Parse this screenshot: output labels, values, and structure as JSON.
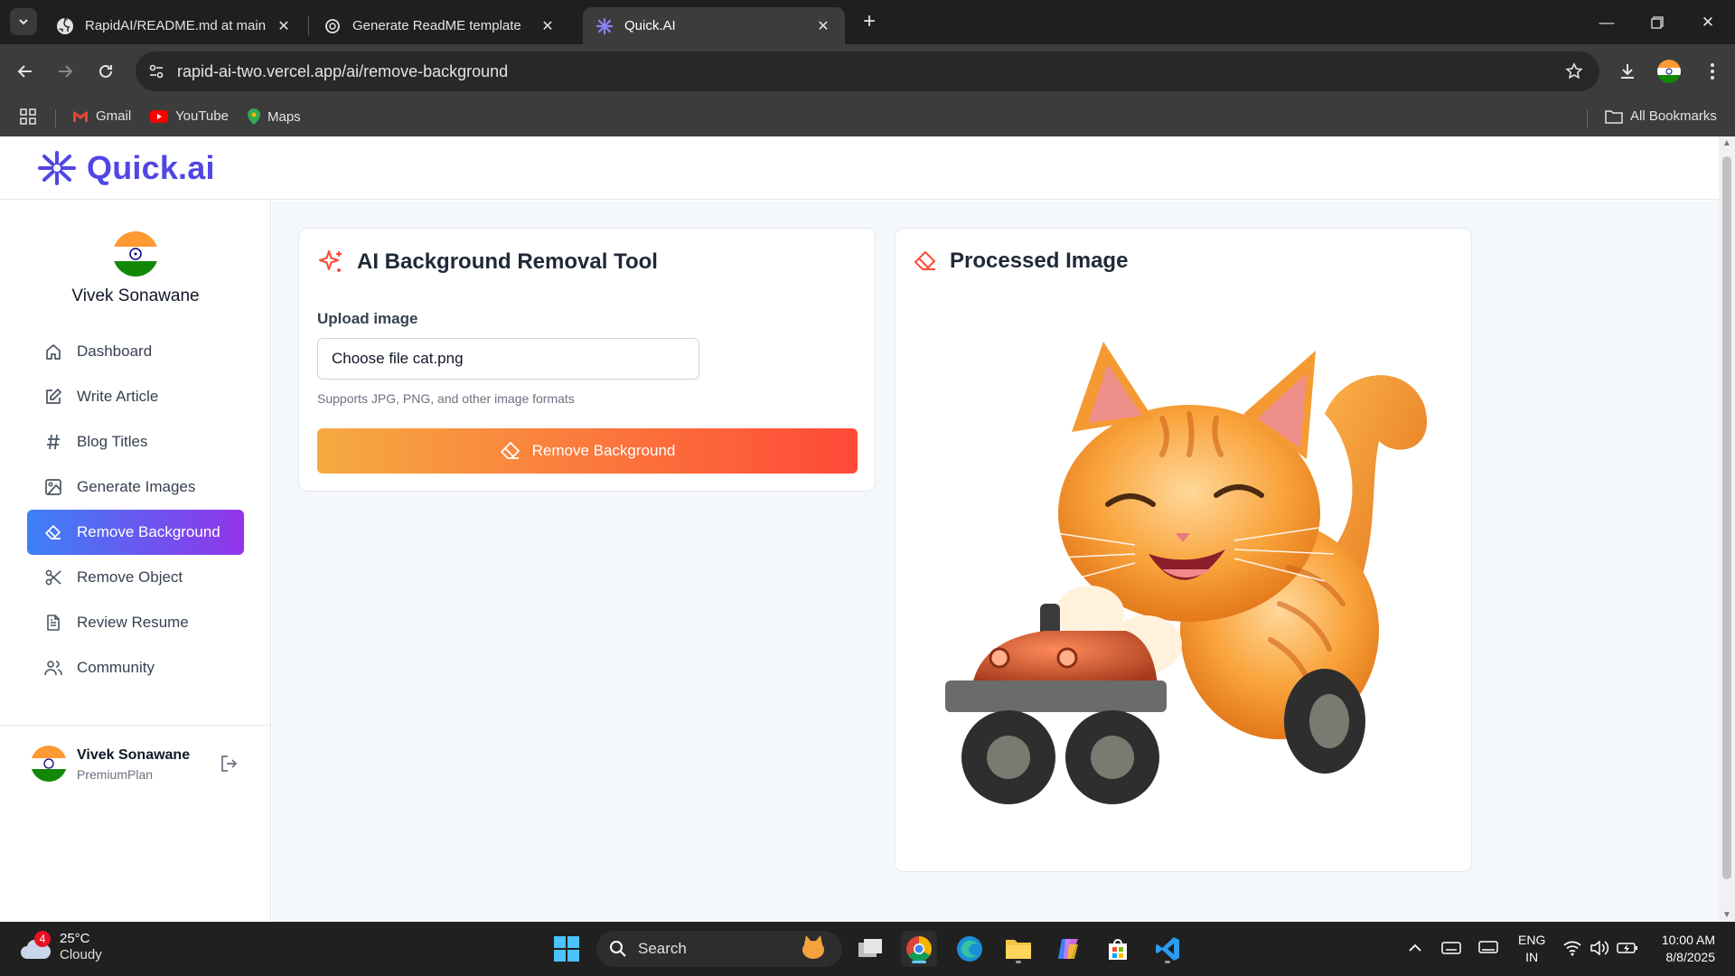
{
  "browser": {
    "tabs": [
      {
        "title": "RapidAI/README.md at main · ",
        "favicon": "github-icon"
      },
      {
        "title": "Generate ReadME template",
        "favicon": "openai-icon"
      },
      {
        "title": "Quick.AI",
        "favicon": "quickai-icon",
        "active": true
      }
    ],
    "url": "rapid-ai-two.vercel.app/ai/remove-background",
    "bookmarks": [
      "Gmail",
      "YouTube",
      "Maps"
    ],
    "all_bookmarks": "All Bookmarks"
  },
  "app": {
    "logo": "Quick.ai",
    "accent": "#5046e5",
    "user": {
      "name": "Vivek Sonawane",
      "plan": "PremiumPlan"
    },
    "nav": [
      {
        "label": "Dashboard",
        "icon": "home-icon"
      },
      {
        "label": "Write Article",
        "icon": "edit-icon"
      },
      {
        "label": "Blog Titles",
        "icon": "hash-icon"
      },
      {
        "label": "Generate Images",
        "icon": "image-icon"
      },
      {
        "label": "Remove Background",
        "icon": "eraser-icon",
        "active": true
      },
      {
        "label": "Remove Object",
        "icon": "scissors-icon"
      },
      {
        "label": "Review Resume",
        "icon": "file-text-icon"
      },
      {
        "label": "Community",
        "icon": "users-icon"
      }
    ],
    "tool_card": {
      "title": "AI Background Removal Tool",
      "upload_label": "Upload image",
      "file_value": "Choose file cat.png",
      "hint": "Supports JPG, PNG, and other image formats",
      "button": "Remove Background"
    },
    "result_card": {
      "title": "Processed Image"
    }
  },
  "taskbar": {
    "weather": {
      "temp": "25°C",
      "condition": "Cloudy",
      "badge": "4"
    },
    "search": "Search",
    "lang": {
      "line1": "ENG",
      "line2": "IN"
    },
    "time": "10:00 AM",
    "date": "8/8/2025"
  }
}
